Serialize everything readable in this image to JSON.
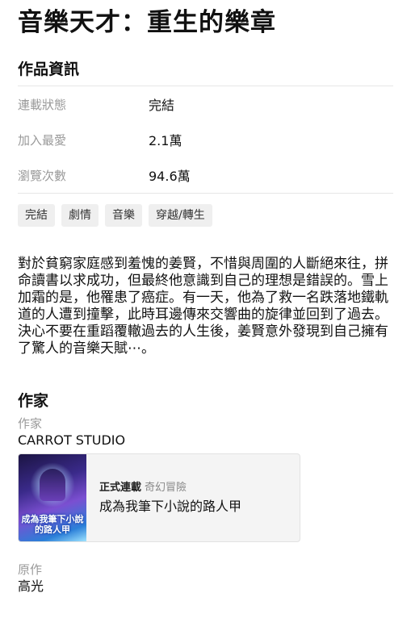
{
  "title": "音樂天才：重生的樂章",
  "info_section": {
    "heading": "作品資訊",
    "rows": [
      {
        "label": "連載狀態",
        "value": "完結"
      },
      {
        "label": "加入最愛",
        "value": "2.1萬"
      },
      {
        "label": "瀏覽次數",
        "value": "94.6萬"
      }
    ]
  },
  "tags": [
    "完結",
    "劇情",
    "音樂",
    "穿越/轉生"
  ],
  "description": "對於貧窮家庭感到羞愧的姜賢，不惜與周圍的人斷絕來往，拼命讀書以求成功，但最終他意識到自己的理想是錯誤的。雪上加霜的是，他罹患了癌症。有一天，他為了救一名跌落地鐵軌道的人遭到撞擊，此時耳邊傳來交響曲的旋律並回到了過去。決心不要在重蹈覆轍過去的人生後，姜賢意外發現到自己擁有了驚人的音樂天賦⋯。",
  "author_section": {
    "heading": "作家",
    "author_label": "作家",
    "author_name": "CARROT STUDIO",
    "related_work": {
      "cover_text": "成為我筆下小說的路人甲",
      "status": "正式連載",
      "genre": "奇幻冒險",
      "title": "成為我筆下小說的路人甲"
    },
    "original_label": "原作",
    "original_name": "高光"
  }
}
